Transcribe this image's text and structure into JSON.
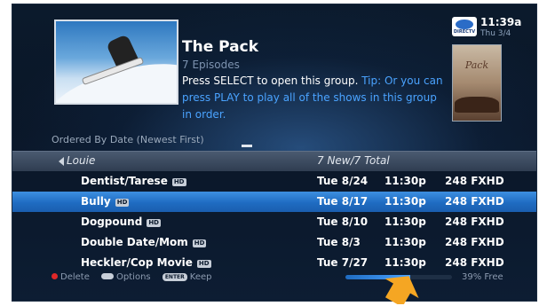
{
  "header": {
    "title": "The Pack",
    "episodes": "7 Episodes",
    "desc_main": "Press SELECT to open this group. ",
    "desc_tip": "Tip: Or you can press PLAY to play all of the shows in this group in order.",
    "time": "11:39a",
    "date": "Thu 3/4",
    "logo_text": "DIRECTV",
    "poster_title": "Pack"
  },
  "sort_label": "Ordered By Date (Newest First)",
  "group": {
    "name": "Louie",
    "count": "7 New/7 Total"
  },
  "rows": [
    {
      "title": "Dentist/Tarese",
      "hd": "HD",
      "date": "Tue 8/24",
      "time": "11:30p",
      "channel": "248 FXHD",
      "selected": false
    },
    {
      "title": "Bully",
      "hd": "HD",
      "date": "Tue 8/17",
      "time": "11:30p",
      "channel": "248 FXHD",
      "selected": true
    },
    {
      "title": "Dogpound",
      "hd": "HD",
      "date": "Tue 8/10",
      "time": "11:30p",
      "channel": "248 FXHD",
      "selected": false
    },
    {
      "title": "Double Date/Mom",
      "hd": "HD",
      "date": "Tue 8/3",
      "time": "11:30p",
      "channel": "248 FXHD",
      "selected": false
    },
    {
      "title": "Heckler/Cop Movie",
      "hd": "HD",
      "date": "Tue 7/27",
      "time": "11:30p",
      "channel": "248 FXHD",
      "selected": false
    }
  ],
  "legend": {
    "delete_label": "Delete",
    "options_label": "Options",
    "enter_label": "ENTER",
    "keep_label": "Keep"
  },
  "storage": {
    "used_fraction": 0.61,
    "free_text": "39% Free"
  },
  "colors": {
    "selection": "#1f6cc2",
    "tip": "#4aa3ff",
    "pointer": "#f5a623",
    "delete_dot": "#e02828"
  },
  "icons": {
    "pointer": "arrow-pointer-icon",
    "delete": "red-button-icon",
    "options": "options-button-icon",
    "back": "back-arrow-icon"
  }
}
